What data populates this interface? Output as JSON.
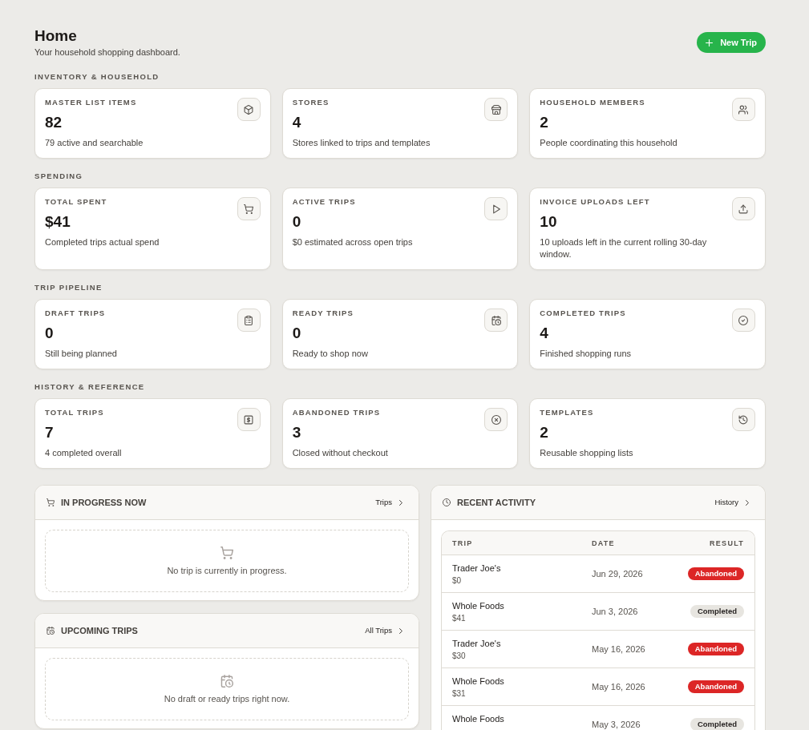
{
  "header": {
    "title": "Home",
    "subtitle": "Your household shopping dashboard.",
    "new_trip_button": {
      "label": "New Trip"
    }
  },
  "sections": [
    {
      "title": "INVENTORY & HOUSEHOLD",
      "cards": [
        {
          "label": "MASTER LIST ITEMS",
          "value": "82",
          "description": "79 active and searchable"
        },
        {
          "label": "STORES",
          "value": "4",
          "description": "Stores linked to trips and templates"
        },
        {
          "label": "HOUSEHOLD MEMBERS",
          "value": "2",
          "description": "People coordinating this household"
        }
      ]
    },
    {
      "title": "SPENDING",
      "cards": [
        {
          "label": "TOTAL SPENT",
          "value": "$41",
          "description": "Completed trips actual spend"
        },
        {
          "label": "ACTIVE TRIPS",
          "value": "0",
          "description": "$0 estimated across open trips"
        },
        {
          "label": "INVOICE UPLOADS LEFT",
          "value": "10",
          "description": "10 uploads left in the current rolling 30-day window."
        }
      ]
    },
    {
      "title": "TRIP PIPELINE",
      "cards": [
        {
          "label": "DRAFT TRIPS",
          "value": "0",
          "description": "Still being planned"
        },
        {
          "label": "READY TRIPS",
          "value": "0",
          "description": "Ready to shop now"
        },
        {
          "label": "COMPLETED TRIPS",
          "value": "4",
          "description": "Finished shopping runs"
        }
      ]
    },
    {
      "title": "HISTORY & REFERENCE",
      "cards": [
        {
          "label": "TOTAL TRIPS",
          "value": "7",
          "description": "4 completed overall"
        },
        {
          "label": "ABANDONED TRIPS",
          "value": "3",
          "description": "Closed without checkout"
        },
        {
          "label": "TEMPLATES",
          "value": "2",
          "description": "Reusable shopping lists"
        }
      ]
    }
  ],
  "in_progress": {
    "title": "IN PROGRESS NOW",
    "link": "Trips",
    "empty_message": "No trip is currently in progress."
  },
  "upcoming_trips": {
    "title": "UPCOMING TRIPS",
    "link": "All Trips",
    "empty_message": "No draft or ready trips right now."
  },
  "recent_activity": {
    "title": "RECENT ACTIVITY",
    "link": "History",
    "table": {
      "columns": [
        "TRIP",
        "DATE",
        "RESULT"
      ],
      "rows": [
        {
          "trip": "Trader Joe's",
          "amount": "$0",
          "date": "Jun 29, 2026",
          "result": "Abandoned",
          "kind": "abandoned"
        },
        {
          "trip": "Whole Foods",
          "amount": "$41",
          "date": "Jun 3, 2026",
          "result": "Completed",
          "kind": "completed"
        },
        {
          "trip": "Trader Joe's",
          "amount": "$30",
          "date": "May 16, 2026",
          "result": "Abandoned",
          "kind": "abandoned"
        },
        {
          "trip": "Whole Foods",
          "amount": "$31",
          "date": "May 16, 2026",
          "result": "Abandoned",
          "kind": "abandoned"
        },
        {
          "trip": "Whole Foods",
          "date": "May 3, 2026",
          "result": "Completed",
          "kind": "completed"
        }
      ]
    }
  }
}
